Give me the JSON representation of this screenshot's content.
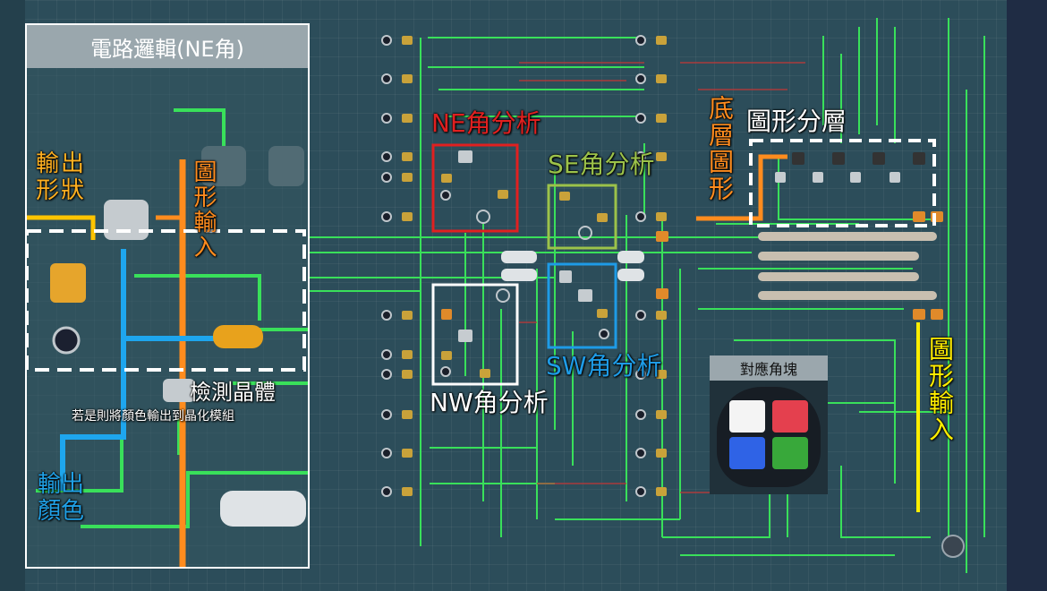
{
  "inset": {
    "title": "電路邏輯(NE角)",
    "output_shape": "輸出形狀",
    "shape_input": "圖形輸入",
    "detect_crystal": "檢測晶體",
    "detect_note": "若是則將顏色輸出到晶化模組",
    "output_color": "輸出顏色"
  },
  "labels": {
    "ne": "NE角分析",
    "se": "SE角分析",
    "sw": "SW角分析",
    "nw": "NW角分析",
    "base_shape": "底層圖形",
    "layering": "圖形分層",
    "shape_input_right": "圖形輸入"
  },
  "legend": {
    "title": "對應角塊",
    "colors": {
      "white": "#f4f4f4",
      "red": "#e4404e",
      "blue": "#2f63e6",
      "green": "#38a83a"
    }
  },
  "colors": {
    "ne": "#e02020",
    "se": "#9cc24a",
    "sw": "#1e9be6",
    "nw": "#ffffff",
    "orange": "#ff8c1e",
    "yellow": "#ffee00",
    "wire": "#39e05a",
    "output_label": "#ffb020",
    "color_label": "#20a0e6"
  }
}
